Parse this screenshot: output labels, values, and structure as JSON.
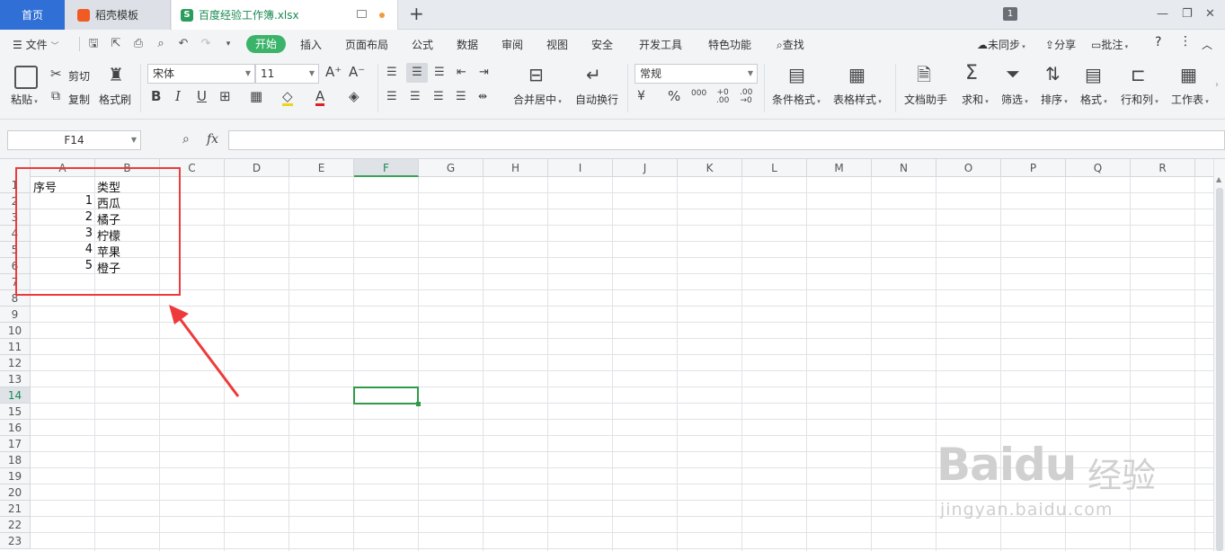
{
  "titlebar": {
    "tab_home": "首页",
    "tab_template": "稻壳模板",
    "tab_file": "百度经验工作簿.xlsx",
    "file_icon_letter": "S",
    "badge": "1"
  },
  "menubar": {
    "file_label": "文件",
    "items": [
      "开始",
      "插入",
      "页面布局",
      "公式",
      "数据",
      "审阅",
      "视图",
      "安全",
      "开发工具",
      "特色功能"
    ],
    "search_label": "查找",
    "sync_label": "未同步",
    "share_label": "分享",
    "comment_label": "批注"
  },
  "ribbon": {
    "paste": "粘贴",
    "cut": "剪切",
    "copy": "复制",
    "format_painter": "格式刷",
    "font_name": "宋体",
    "font_size": "11",
    "merge_center": "合并居中",
    "wrap_text": "自动换行",
    "number_format": "常规",
    "cond_format": "条件格式",
    "table_style": "表格样式",
    "doc_helper": "文档助手",
    "sum": "求和",
    "filter": "筛选",
    "sort": "排序",
    "format": "格式",
    "row_col": "行和列",
    "worksheet": "工作表"
  },
  "formula_bar": {
    "name_box": "F14",
    "fx": "fx",
    "formula": ""
  },
  "sheet": {
    "columns": [
      "A",
      "B",
      "C",
      "D",
      "E",
      "F",
      "G",
      "H",
      "I",
      "J",
      "K",
      "L",
      "M",
      "N",
      "O",
      "P",
      "Q",
      "R"
    ],
    "rows": [
      "1",
      "2",
      "3",
      "4",
      "5",
      "6",
      "7",
      "8",
      "9",
      "10",
      "11",
      "12",
      "13",
      "14",
      "15",
      "16",
      "17",
      "18",
      "19",
      "20",
      "21",
      "22",
      "23"
    ],
    "selected_cell": "F14",
    "header": {
      "a": "序号",
      "b": "类型"
    },
    "data": [
      {
        "a": "1",
        "b": "西瓜"
      },
      {
        "a": "2",
        "b": "橘子"
      },
      {
        "a": "3",
        "b": "柠檬"
      },
      {
        "a": "4",
        "b": "苹果"
      },
      {
        "a": "5",
        "b": "橙子"
      }
    ]
  },
  "watermark": {
    "logo": "Baidu",
    "cn": "经验",
    "url": "jingyan.baidu.com"
  },
  "colors": {
    "accent_green": "#3bb36a",
    "home_tab_blue": "#2f6fd6",
    "annotation_red": "#ee3a3a"
  }
}
